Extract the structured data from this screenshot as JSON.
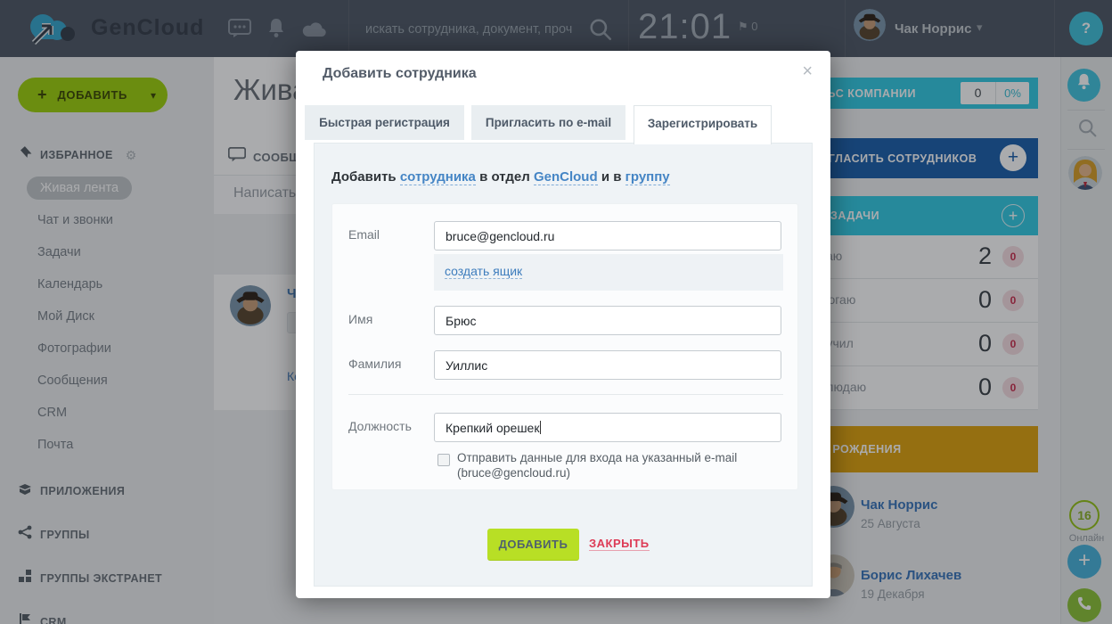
{
  "header": {
    "logo": "GenCloud",
    "search_placeholder": "искать сотрудника, документ, проч",
    "time": "21:01",
    "flag_count": "0",
    "user_name": "Чак Норрис",
    "help": "?"
  },
  "sidebar": {
    "add_button": "ДОБАВИТЬ",
    "favorites": "ИЗБРАННОЕ",
    "items": [
      "Живая лента",
      "Чат и звонки",
      "Задачи",
      "Календарь",
      "Мой Диск",
      "Фотографии",
      "Сообщения",
      "CRM",
      "Почта"
    ],
    "sections": [
      "ПРИЛОЖЕНИЯ",
      "ГРУППЫ",
      "ГРУППЫ ЭКСТРАНЕТ",
      "CRM"
    ]
  },
  "main": {
    "page_title": "Живая лента",
    "messages_tab": "СООБЩЕНИЯ",
    "composer_placeholder": "Написать сообщение...",
    "feed_author": "Чак Норрис",
    "comment_link": "Комментировать"
  },
  "widgets": {
    "pulse": {
      "title": "ПУЛЬС КОМПАНИИ",
      "value": "0",
      "percent": "0%"
    },
    "invite_title": "ПРИГЛАСИТЬ СОТРУДНИКОВ",
    "tasks": {
      "title": "ЗАДАЧИ",
      "rows": [
        {
          "label": "Делаю",
          "count": "2",
          "badge": "0"
        },
        {
          "label": "Помогаю",
          "count": "0",
          "badge": "0"
        },
        {
          "label": "Поручил",
          "count": "0",
          "badge": "0"
        },
        {
          "label": "Наблюдаю",
          "count": "0",
          "badge": "0"
        }
      ]
    },
    "birthdays": {
      "title": "ДНИ РОЖДЕНИЯ",
      "entries": [
        {
          "name": "Чак Норрис",
          "date": "25 Августа"
        },
        {
          "name": "Борис Лихачев",
          "date": "19 Декабря"
        }
      ]
    }
  },
  "rail": {
    "online_count": "16",
    "online_label": "Онлайн"
  },
  "modal": {
    "title": "Добавить сотрудника",
    "close": "×",
    "tabs": [
      "Быстрая регистрация",
      "Пригласить по e-mail",
      "Зарегистрировать"
    ],
    "heading": {
      "pre": "Добавить",
      "link_employee": "сотрудника",
      "mid1": "в отдел",
      "link_dept": "GenCloud",
      "mid2": "и в",
      "link_group": "группу"
    },
    "fields": [
      {
        "label": "Email",
        "value": "bruce@gencloud.ru"
      },
      {
        "label": "Имя",
        "value": "Брюс"
      },
      {
        "label": "Фамилия",
        "value": "Уиллис"
      },
      {
        "label": "Должность",
        "value": "Крепкий орешек"
      }
    ],
    "create_mailbox_link": "создать ящик",
    "checkbox_line1": "Отправить данные для входа на указанный e-mail",
    "checkbox_line2": "(bruce@gencloud.ru)",
    "submit": "ДОБАВИТЬ",
    "cancel": "ЗАКРЫТЬ"
  },
  "colors": {
    "header_dark": "#535c69",
    "accent_green": "#a0d211",
    "button_green": "#b8df25",
    "accent_teal": "#38cbe4",
    "accent_blue": "#2063ae",
    "accent_gold": "#dfa413",
    "link_blue": "#4585c5",
    "danger_red": "#dd3b56"
  }
}
